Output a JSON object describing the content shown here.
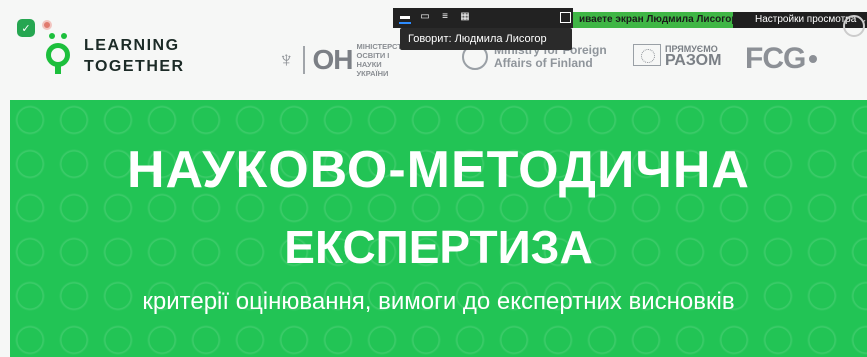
{
  "header": {
    "logo": {
      "line1": "LEARNING",
      "line2": "TOGETHER"
    },
    "partners": {
      "ministry": {
        "abbr": "ОН",
        "text": "МІНІСТЕРСТВО ОСВІТИ І НАУКИ УКРАЇНИ"
      },
      "finland": {
        "text_line1": "Ministry for Foreign",
        "text_line2": "Affairs of Finland"
      },
      "razom": {
        "small": "ПРЯМУЄМО",
        "big": "РАЗОМ"
      },
      "fcg": "FCG"
    }
  },
  "slide": {
    "title_line1": "НАУКОВО-МЕТОДИЧНА",
    "title_line2": "ЕКСПЕРТИЗА",
    "subtitle": "критерії оцінювання, вимоги до експертних висновків"
  },
  "zoom": {
    "share_banner": "иваете экран Людмила Лисогор",
    "view_options": "Настройки просмотра",
    "speaker": "Говорит: Людмила Лисогор"
  },
  "colors": {
    "brand_green": "#1cbf3c",
    "slide_green": "#22c455",
    "share_green": "#3fb645"
  }
}
